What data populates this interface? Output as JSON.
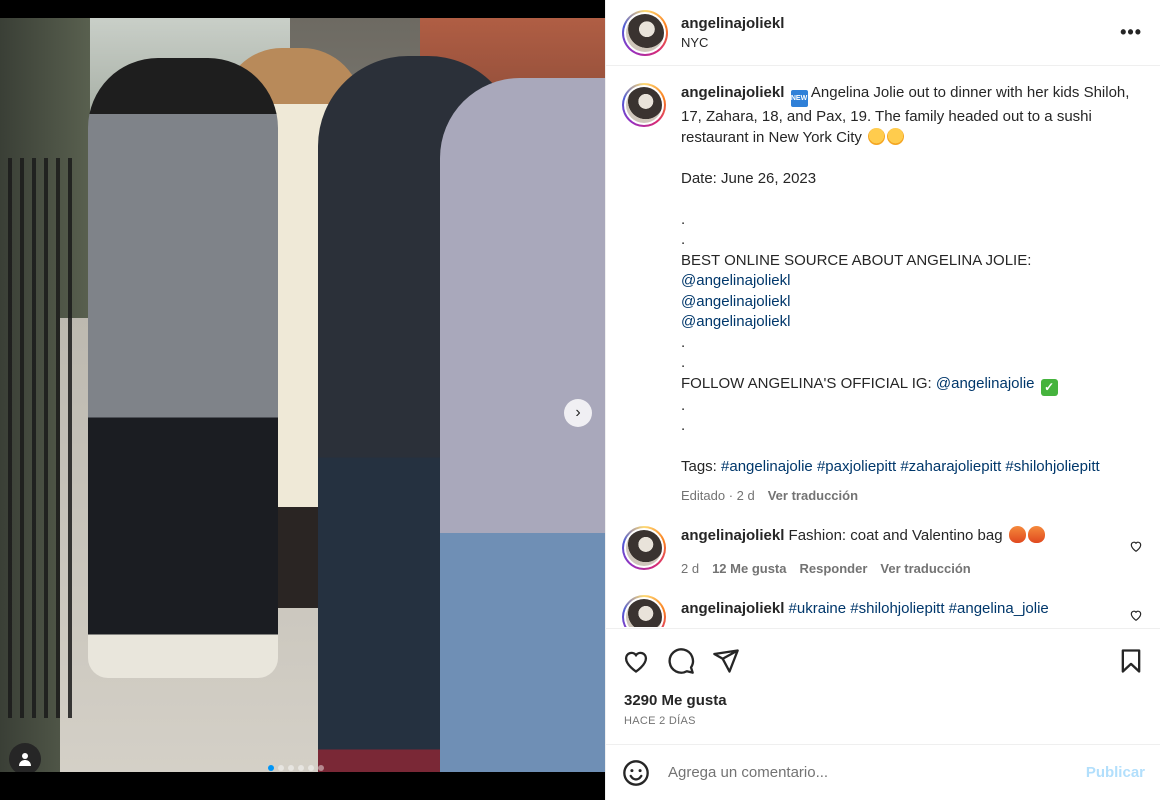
{
  "post": {
    "username": "angelinajoliekl",
    "location": "NYC",
    "more_icon": "more-horizontal-icon"
  },
  "media": {
    "image_count": 6,
    "active_index": 0,
    "next_icon": "chevron-right-icon",
    "tag_icon": "user-tag-icon"
  },
  "caption": {
    "username": "angelinajoliekl",
    "badge_icon": "new-emoji",
    "text_line1": " Angelina Jolie out to dinner with her kids",
    "text_line2": "Shiloh, 17, Zahara, 18, and Pax, 19. The family headed out to a",
    "text_line3": "sushi restaurant in New York City",
    "date_line": "Date: June 26, 2023",
    "dot": ".",
    "source_label": "BEST ONLINE SOURCE ABOUT ANGELINA JOLIE:",
    "source_links": [
      "@angelinajoliekl",
      "@angelinajoliekl",
      "@angelinajoliekl"
    ],
    "follow_label": "FOLLOW ANGELINA'S OFFICIAL IG: ",
    "follow_link": "@angelinajolie",
    "tags_label": "Tags: ",
    "tags": [
      "#angelinajolie",
      "#paxjoliepitt",
      "#zaharajoliepitt",
      "#shilohjoliepitt"
    ],
    "meta_edited": "Editado · 2 d",
    "meta_translate": "Ver traducción"
  },
  "comments": [
    {
      "username": "angelinajoliekl",
      "text": " Fashion: coat and Valentino bag",
      "time": "2 d",
      "likes": "12 Me gusta",
      "reply": "Responder",
      "translate": "Ver traducción"
    },
    {
      "username": "angelinajoliekl",
      "tags": [
        "#ukraine",
        "#shilohjoliepitt",
        "#angelina_jolie"
      ]
    }
  ],
  "actions": {
    "like_icon": "heart-icon",
    "comment_icon": "comment-icon",
    "share_icon": "share-icon",
    "save_icon": "bookmark-icon",
    "likes": "3290 Me gusta",
    "date": "HACE 2 DÍAS"
  },
  "add_comment": {
    "placeholder": "Agrega un comentario...",
    "post_label": "Publicar",
    "emoji_icon": "smile-icon"
  },
  "colors": {
    "link": "#00376b",
    "active_dot": "#0095f6",
    "post_disabled": "#b2dffc",
    "meta": "#737373"
  }
}
